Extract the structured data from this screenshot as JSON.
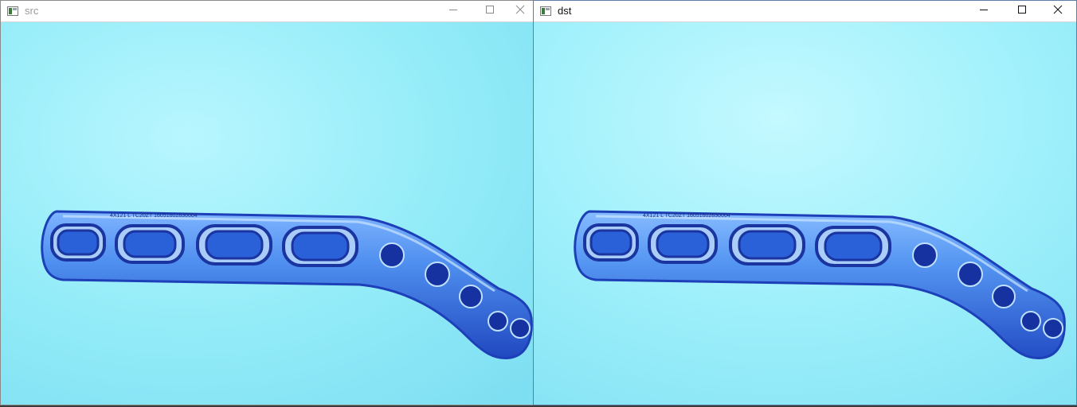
{
  "windows": {
    "src": {
      "title": "src",
      "buttons": {
        "minimize": "minimize-icon",
        "maximize": "maximize-icon",
        "close": "close-icon"
      }
    },
    "dst": {
      "title": "dst",
      "buttons": {
        "minimize": "minimize-icon",
        "maximize": "maximize-icon",
        "close": "close-icon"
      }
    }
  },
  "image": {
    "engraving": "4X121 L TC20ZT 16051602830004",
    "colors": {
      "background": "#8fe8f5",
      "background_light": "#b8f6ff",
      "plate": "#4f8fef",
      "plate_dark": "#1d3fb8",
      "plate_highlight": "#c9e6ff"
    }
  }
}
